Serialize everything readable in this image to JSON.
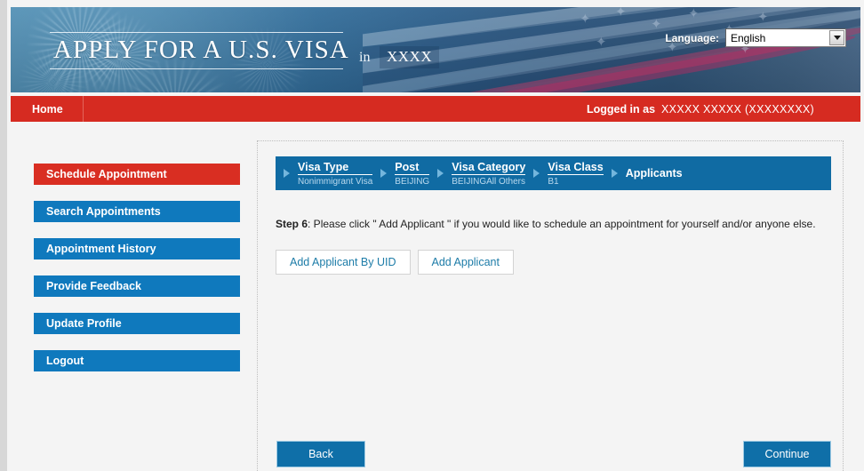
{
  "header": {
    "title": "APPLY FOR A U.S. VISA",
    "in_word": "in",
    "location": "XXXX",
    "language_label": "Language:",
    "language_value": "English",
    "dropdown_icon": "chevron-down-icon"
  },
  "navbar": {
    "home": "Home",
    "logged_in_label": "Logged in as",
    "logged_in_user": "XXXXX XXXXX (XXXXXXXX)"
  },
  "sidebar": {
    "items": [
      {
        "label": "Schedule Appointment",
        "active": true
      },
      {
        "label": "Search Appointments",
        "active": false
      },
      {
        "label": "Appointment History",
        "active": false
      },
      {
        "label": "Provide Feedback",
        "active": false
      },
      {
        "label": "Update Profile",
        "active": false
      },
      {
        "label": "Logout",
        "active": false
      }
    ]
  },
  "breadcrumb": {
    "steps": [
      {
        "title": "Visa Type",
        "sub": "Nonimmigrant Visa"
      },
      {
        "title": "Post",
        "sub": "BEIJING"
      },
      {
        "title": "Visa Category",
        "sub": "BEIJINGAll Others"
      },
      {
        "title": "Visa Class",
        "sub": "B1"
      },
      {
        "title": "Applicants",
        "sub": ""
      }
    ]
  },
  "main": {
    "step_label": "Step 6",
    "step_instruction": ": Please click \" Add Applicant \" if you would like to schedule an appointment for yourself and/or anyone else.",
    "add_applicant_by_uid": "Add Applicant By UID",
    "add_applicant": "Add Applicant",
    "back": "Back",
    "continue": "Continue"
  },
  "colors": {
    "red": "#d62b21",
    "blue": "#0f79bd",
    "panel_blue": "#106ba3",
    "link_blue": "#1d7ca8"
  }
}
